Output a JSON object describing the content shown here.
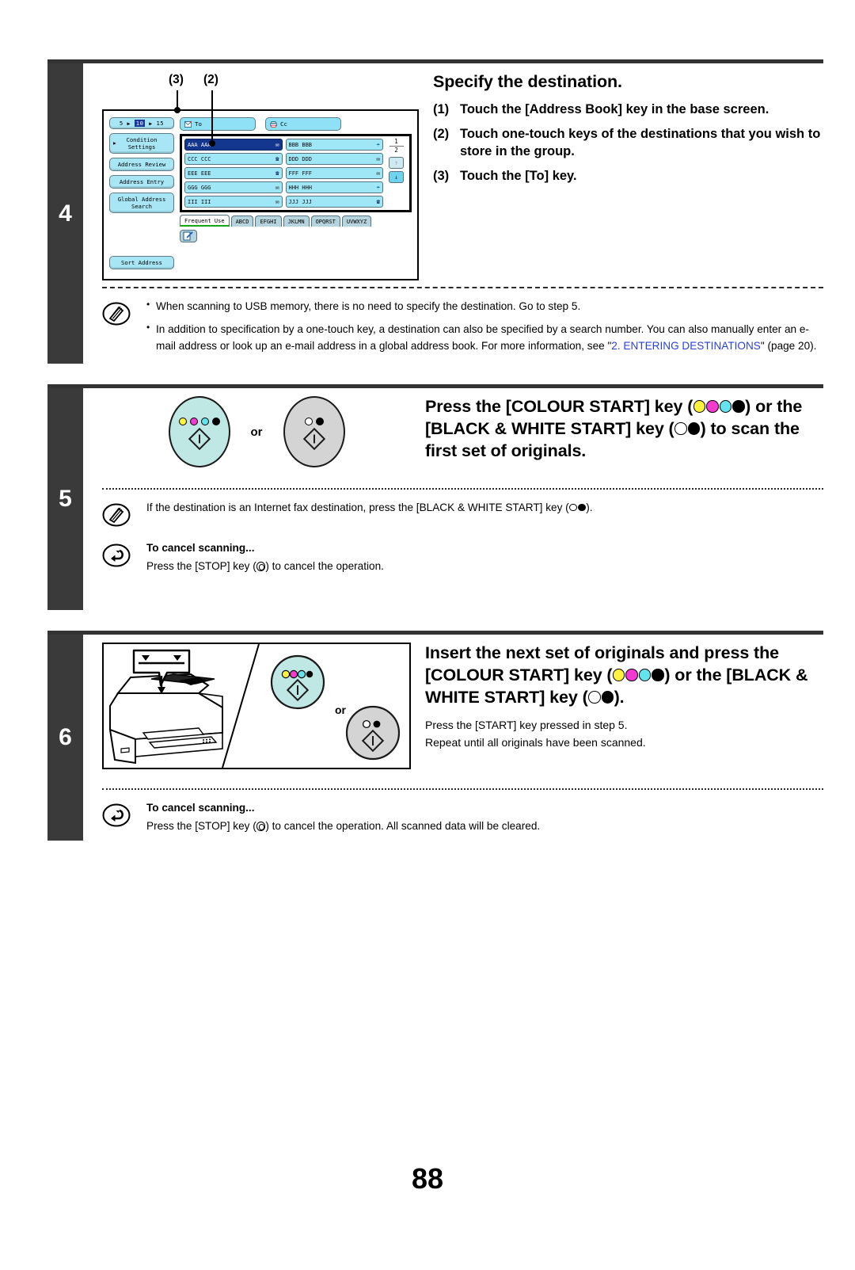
{
  "page": {
    "number": "88"
  },
  "steps": [
    {
      "number": "4",
      "heading": "Specify the destination.",
      "substeps": [
        {
          "n": "(1)",
          "text": "Touch the [Address Book] key in the base screen."
        },
        {
          "n": "(2)",
          "text": "Touch one-touch keys of the destinations that you wish to store in the group."
        },
        {
          "n": "(3)",
          "text": "Touch the [To] key."
        }
      ],
      "callouts": [
        {
          "label": "(3)"
        },
        {
          "label": "(2)"
        }
      ],
      "note": {
        "icon": "pencil-note-icon",
        "bullets": [
          {
            "text": "When scanning to USB memory, there is no need to specify the destination. Go to step 5."
          },
          {
            "pre": "In addition to specification by a one-touch key, a destination can also be specified by a search number. You can also manually enter an e-mail address or look up an e-mail address in a global address book. For more information, see \"",
            "link": "2. ENTERING DESTINATIONS",
            "post": "\" (page 20)."
          }
        ]
      }
    },
    {
      "number": "5",
      "heading_parts": [
        {
          "t": "Press the [COLOUR START] key ("
        },
        {
          "dots": [
            "y",
            "m",
            "c",
            "k"
          ]
        },
        {
          "t": ") or the [BLACK & WHITE START] key ("
        },
        {
          "dots": [
            "w",
            "k"
          ]
        },
        {
          "t": ") to scan the first set of originals."
        }
      ],
      "or_label": "or",
      "note": {
        "icon": "pencil-note-icon",
        "pre": "If the destination is an Internet fax destination, press the [BLACK & WHITE START] key (",
        "dots": [
          "w",
          "k"
        ],
        "post": ")."
      },
      "cancel": {
        "icon": "undo-arrow-icon",
        "title": "To cancel scanning...",
        "pre": "Press the [STOP] key (",
        "glyph": "stop-key-icon",
        "post": ") to cancel the operation."
      }
    },
    {
      "number": "6",
      "heading_parts": [
        {
          "t": "Insert the next set of originals and press the [COLOUR START] key ("
        },
        {
          "dots": [
            "y",
            "m",
            "c",
            "k"
          ]
        },
        {
          "t": ") or the [BLACK & WHITE START] key ("
        },
        {
          "dots": [
            "w",
            "k"
          ]
        },
        {
          "t": ")."
        }
      ],
      "or_label": "or",
      "body_lines": [
        "Press the [START] key pressed in step 5.",
        "Repeat until all originals have been scanned."
      ],
      "cancel": {
        "icon": "undo-arrow-icon",
        "title": "To cancel scanning...",
        "pre": "Press the [STOP] key (",
        "glyph": "stop-key-icon",
        "post": ") to cancel the operation. All scanned data will be cleared."
      }
    }
  ],
  "lcd": {
    "counter": {
      "left": "5",
      "current": "10",
      "right": "15"
    },
    "left_buttons": [
      {
        "label": "Condition Settings",
        "has_arrow": true
      },
      {
        "label": "Address Review",
        "has_arrow": false
      },
      {
        "label": "Address Entry",
        "has_arrow": false
      },
      {
        "label": "Global Address Search",
        "has_arrow": false
      }
    ],
    "sort_button": "Sort Address",
    "top_keys": [
      {
        "label": "To",
        "icon": "envelope-icon"
      },
      {
        "label": "Cc",
        "icon": "printer-icon"
      }
    ],
    "one_touch": [
      {
        "label": "AAA AAA",
        "icon": "envelope-icon",
        "selected": true
      },
      {
        "label": "BBB BBB",
        "icon": "globe-icon",
        "selected": false
      },
      {
        "label": "CCC CCC",
        "icon": "phone-icon",
        "selected": false
      },
      {
        "label": "DDD DDD",
        "icon": "envelope-icon",
        "selected": false
      },
      {
        "label": "EEE EEE",
        "icon": "phone-icon",
        "selected": false
      },
      {
        "label": "FFF FFF",
        "icon": "envelope-icon",
        "selected": false
      },
      {
        "label": "GGG GGG",
        "icon": "envelope-icon",
        "selected": false
      },
      {
        "label": "HHH HHH",
        "icon": "globe-icon",
        "selected": false
      },
      {
        "label": "III III",
        "icon": "envelope-icon",
        "selected": false
      },
      {
        "label": "JJJ JJJ",
        "icon": "phone-icon",
        "selected": false
      }
    ],
    "page_indicator": {
      "current": "1",
      "total": "2"
    },
    "nav": {
      "up": "↑",
      "down": "↓"
    },
    "tabs": [
      {
        "label": "Frequent Use",
        "active": true
      },
      {
        "label": "ABCD",
        "active": false
      },
      {
        "label": "EFGHI",
        "active": false
      },
      {
        "label": "JKLMN",
        "active": false
      },
      {
        "label": "OPQRST",
        "active": false
      },
      {
        "label": "UVWXYZ",
        "active": false
      }
    ],
    "edit_button": "edit-icon"
  },
  "colors": {
    "step_bar": "#3a3a3a",
    "lcd_key": "#9fe6f7",
    "lcd_selected": "#13378f",
    "link": "#2b41d6",
    "colour_key": "#bfe7e3",
    "bw_key": "#d4d4d4",
    "yellow": "#fff33f",
    "magenta": "#f23ad0",
    "cyan": "#63e3ec",
    "tab_active_underline": "#17a817"
  }
}
